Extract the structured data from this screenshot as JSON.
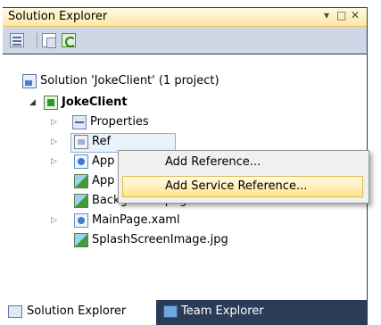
{
  "panel": {
    "title": "Solution Explorer",
    "dropdown_glyph": "▾",
    "maximize_glyph": "□",
    "close_glyph": "✕"
  },
  "toolbar": {
    "icons": [
      "properties-icon",
      "show-all-files-icon",
      "refresh-icon"
    ]
  },
  "tree": {
    "solution_label": "Solution 'JokeClient' (1 project)",
    "project_label": "JokeClient",
    "items": [
      {
        "label": "Properties",
        "icon": "properties-folder-icon",
        "expander": "▷"
      },
      {
        "label": "Ref",
        "icon": "references-icon",
        "expander": "▷"
      },
      {
        "label": "App",
        "icon": "xaml-file-icon",
        "expander": "▷"
      },
      {
        "label": "App",
        "icon": "image-file-icon",
        "expander": ""
      },
      {
        "label": "Background.png",
        "icon": "image-file-icon",
        "expander": ""
      },
      {
        "label": "MainPage.xaml",
        "icon": "xaml-file-icon",
        "expander": "▷"
      },
      {
        "label": "SplashScreenImage.jpg",
        "icon": "image-file-icon",
        "expander": ""
      }
    ],
    "project_expander": "◢"
  },
  "context_menu": {
    "items": [
      {
        "label": "Add Reference..."
      },
      {
        "label": "Add Service Reference...",
        "highlighted": true
      }
    ]
  },
  "tabs": [
    {
      "label": "Solution Explorer",
      "active": true,
      "icon": "solution-explorer-icon"
    },
    {
      "label": "Team Explorer",
      "active": false,
      "icon": "team-explorer-icon"
    }
  ]
}
